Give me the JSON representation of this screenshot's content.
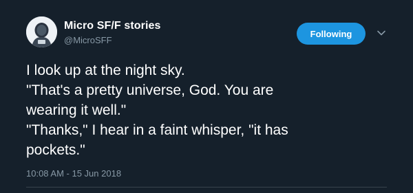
{
  "author": {
    "name": "Micro SF/F stories",
    "handle": "@MicroSFF"
  },
  "follow_button": {
    "label": "Following"
  },
  "tweet": {
    "lines": [
      "I look up at the night sky.",
      "\"That's a pretty universe, God. You are",
      "wearing it well.\"",
      "\"Thanks,\" I hear in a faint whisper, \"it has",
      "pockets.\""
    ],
    "timestamp": "10:08 AM - 15 Jun 2018"
  },
  "icons": {
    "avatar": "astronaut-avatar",
    "menu": "chevron-down-icon"
  },
  "colors": {
    "background": "#15202b",
    "accent": "#1d95e0",
    "secondary_text": "#8899a6"
  }
}
